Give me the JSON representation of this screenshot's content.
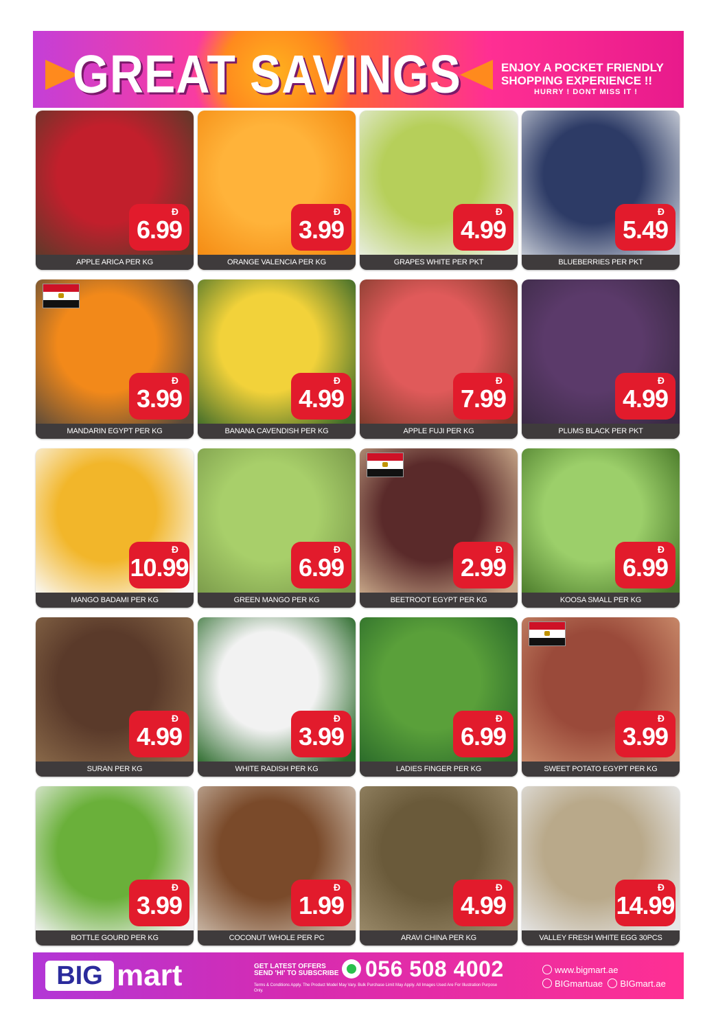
{
  "banner": {
    "title": "GREAT SAVINGS",
    "tagline_1": "ENJOY A POCKET FRIENDLY",
    "tagline_2": "SHOPPING EXPERIENCE !!",
    "tagline_3": "HURRY ! DONT MISS IT !"
  },
  "currency_symbol": "Đ",
  "products": [
    {
      "name": "APPLE ARICA PER KG",
      "price": "6.99",
      "flag": false,
      "photo": [
        "#5b3a2a",
        "#c21f2c"
      ]
    },
    {
      "name": "ORANGE VALENCIA PER KG",
      "price": "3.99",
      "flag": false,
      "photo": [
        "#f48a12",
        "#ffb33a"
      ]
    },
    {
      "name": "GRAPES WHITE PER PKT",
      "price": "4.99",
      "flag": false,
      "photo": [
        "#e9eee3",
        "#b6cf5a"
      ]
    },
    {
      "name": "BLUEBERRIES PER PKT",
      "price": "5.49",
      "flag": false,
      "photo": [
        "#c7ccd6",
        "#2d3b66"
      ]
    },
    {
      "name": "MANDARIN EGYPT PER KG",
      "price": "3.99",
      "flag": true,
      "photo": [
        "#5a4a3a",
        "#f2891a"
      ]
    },
    {
      "name": "BANANA CAVENDISH PER KG",
      "price": "4.99",
      "flag": false,
      "photo": [
        "#3e6b2a",
        "#f2d23a"
      ]
    },
    {
      "name": "APPLE FUJI PER KG",
      "price": "7.99",
      "flag": false,
      "photo": [
        "#7a3a2a",
        "#e05a5a"
      ]
    },
    {
      "name": "PLUMS BLACK PER PKT",
      "price": "4.99",
      "flag": false,
      "photo": [
        "#3a2a44",
        "#5b3a6a"
      ]
    },
    {
      "name": "MANGO BADAMI PER KG",
      "price": "10.99",
      "flag": false,
      "photo": [
        "#fafafa",
        "#f2b62a"
      ]
    },
    {
      "name": "GREEN MANGO PER KG",
      "price": "6.99",
      "flag": false,
      "photo": [
        "#7a9a4a",
        "#a8cf6a"
      ]
    },
    {
      "name": "BEETROOT EGYPT PER KG",
      "price": "2.99",
      "flag": true,
      "photo": [
        "#c9a98a",
        "#5a2a2a"
      ]
    },
    {
      "name": "KOOSA SMALL PER KG",
      "price": "6.99",
      "flag": false,
      "photo": [
        "#4a7a2a",
        "#9ccf6a"
      ]
    },
    {
      "name": "SURAN PER KG",
      "price": "4.99",
      "flag": false,
      "photo": [
        "#8a6a4a",
        "#5a3a2a"
      ]
    },
    {
      "name": "WHITE RADISH PER KG",
      "price": "3.99",
      "flag": false,
      "photo": [
        "#2a6a2a",
        "#f2f2f2"
      ]
    },
    {
      "name": "LADIES FINGER PER KG",
      "price": "6.99",
      "flag": false,
      "photo": [
        "#2a6a2a",
        "#5aa03a"
      ]
    },
    {
      "name": "SWEET POTATO EGYPT PER KG",
      "price": "3.99",
      "flag": true,
      "photo": [
        "#c98a6a",
        "#9a4a3a"
      ]
    },
    {
      "name": "BOTTLE GOURD PER KG",
      "price": "3.99",
      "flag": false,
      "photo": [
        "#f2f2f2",
        "#6ab03a"
      ]
    },
    {
      "name": "COCONUT WHOLE PER PC",
      "price": "1.99",
      "flag": false,
      "photo": [
        "#c9b7a6",
        "#7a4a2a"
      ]
    },
    {
      "name": "ARAVI CHINA PER KG",
      "price": "4.99",
      "flag": false,
      "photo": [
        "#9a8a6a",
        "#6a5a3a"
      ]
    },
    {
      "name": "VALLEY FRESH WHITE EGG 30PCS",
      "price": "14.99",
      "flag": false,
      "photo": [
        "#e6e6e6",
        "#b9a98a"
      ]
    }
  ],
  "footer": {
    "logo_big": "BIG",
    "logo_mart": "mart",
    "subscribe_1": "GET LATEST OFFERS",
    "subscribe_2": "SEND 'HI' TO SUBSCRIBE",
    "phone": "056 508 4002",
    "terms": "Terms & Conditions Apply. The Product Model May Vary. Bulk Purchase Limit May Apply. All Images Used Are For Illustration Purpose Only.",
    "website": "www.bigmart.ae",
    "facebook": "BIGmartuae",
    "instagram": "BIGmart.ae"
  }
}
